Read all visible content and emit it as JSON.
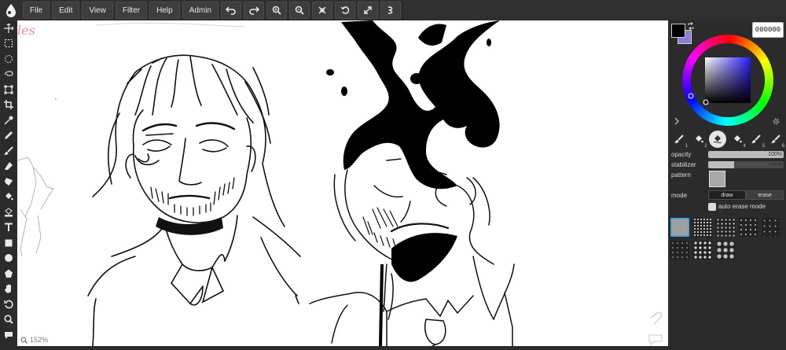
{
  "menu": {
    "items": [
      {
        "label": "File"
      },
      {
        "label": "Edit"
      },
      {
        "label": "View"
      },
      {
        "label": "Filter"
      },
      {
        "label": "Help"
      },
      {
        "label": "Admin"
      }
    ],
    "actions": [
      "undo-icon",
      "redo-icon",
      "zoom-in-icon",
      "zoom-out-icon",
      "reset-zoom-icon",
      "rotate-icon",
      "fullscreen-icon",
      "stabilizer-icon"
    ]
  },
  "tools": [
    "move-icon",
    "select-rect-icon",
    "select-ellipse-icon",
    "lasso-icon",
    "transform-icon",
    "crop-icon",
    "eyedropper-icon",
    "pen-icon",
    "brush-icon",
    "eraser-icon",
    "smudge-icon",
    "bucket-icon",
    "gradient-icon",
    "text-icon",
    "rectangle-icon",
    "ellipse-icon",
    "shape-icon",
    "hand-icon",
    "rotate-view-icon",
    "zoom-icon",
    "comment-icon"
  ],
  "canvas": {
    "zoom_label": "152%",
    "corner_text": "les"
  },
  "color": {
    "hex": "000000",
    "primary": "#000000",
    "secondary": "#8a7dd8"
  },
  "brushes": [
    {
      "num": "1"
    },
    {
      "num": "2"
    },
    {
      "num": "3"
    },
    {
      "num": "4"
    },
    {
      "num": "5"
    },
    {
      "num": "6"
    }
  ],
  "settings": {
    "opacity_label": "opacity",
    "opacity_value": "100%",
    "opacity_fraction": 1.0,
    "stabilizer_label": "stabilizer",
    "stabilizer_value": "34%",
    "stabilizer_fraction": 0.34,
    "pattern_label": "pattern",
    "mode_label": "mode",
    "mode_draw": "draw",
    "mode_erase": "erase",
    "auto_erase_label": "auto erase mode"
  }
}
